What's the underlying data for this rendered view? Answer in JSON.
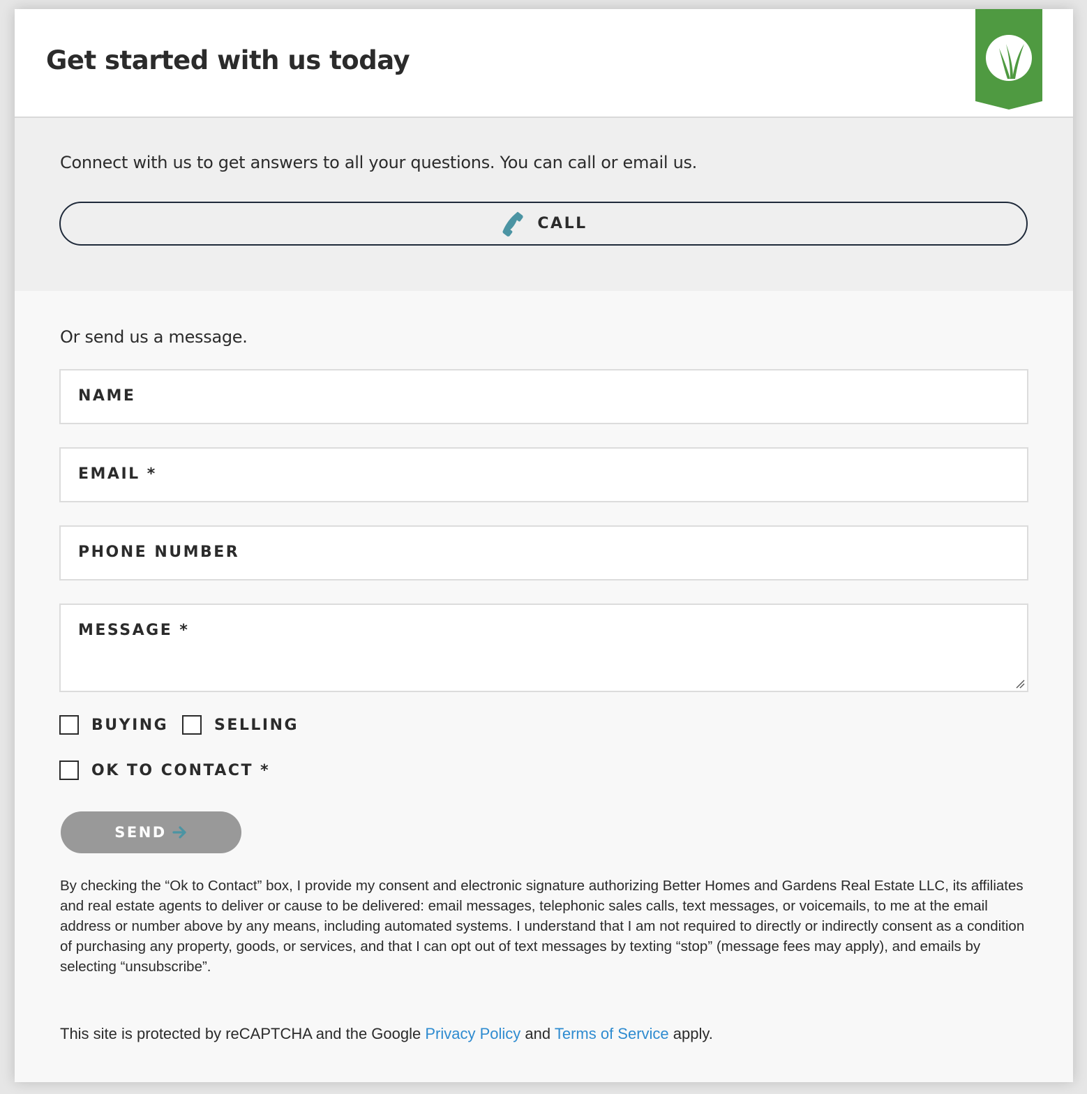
{
  "header": {
    "title": "Get started with us today",
    "logo_icon": "grass-leaf-logo-icon",
    "logo_color": "#4f9a41"
  },
  "call_section": {
    "intro": "Connect with us to get answers to all your questions. You can call or email us.",
    "call_label": "CALL",
    "call_icon": "phone-icon",
    "icon_color": "#4b94a3"
  },
  "form": {
    "prompt": "Or send us a message.",
    "fields": {
      "name": "NAME",
      "email": "EMAIL *",
      "phone": "PHONE NUMBER",
      "message": "MESSAGE *"
    },
    "checkboxes": {
      "buying": "BUYING",
      "selling": "SELLING",
      "ok_to_contact": "OK TO CONTACT *"
    },
    "send_label": "SEND",
    "send_icon": "arrow-right-icon"
  },
  "consent_text": "By checking the “Ok to Contact” box, I provide my consent and electronic signature authorizing Better Homes and Gardens Real Estate LLC, its affiliates and real estate agents to deliver or cause to be delivered: email messages, telephonic sales calls, text messages, or voicemails, to me at the email address or number above by any means, including automated systems. I understand that I am not required to directly or indirectly consent as a condition of purchasing any property, goods, or services, and that I can opt out of text messages by texting “stop” (message fees may apply), and emails by selecting “unsubscribe”.",
  "recaptcha": {
    "prefix": "This site is protected by reCAPTCHA and the Google ",
    "privacy_link": "Privacy Policy",
    "and": " and ",
    "terms_link": "Terms of Service",
    "suffix": " apply.",
    "link_color": "#2e8bd0"
  }
}
